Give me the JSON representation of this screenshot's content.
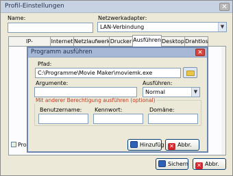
{
  "window": {
    "title": "Profil-Einstellungen",
    "close_glyph": "✕"
  },
  "name": {
    "label": "Name:",
    "value": ""
  },
  "adapter": {
    "label": "Netzwerkadapter:",
    "value": "LAN-Verbindung",
    "arrow": "▼"
  },
  "tabs": [
    {
      "label": "IP-Einstellungen"
    },
    {
      "label": "Internet"
    },
    {
      "label": "Netzlaufwerke"
    },
    {
      "label": "Drucker"
    },
    {
      "label": "Ausführen",
      "active": true
    },
    {
      "label": "Desktop"
    },
    {
      "label": "Drahtlos"
    }
  ],
  "panel": {
    "partial_label": "Pro"
  },
  "footer": {
    "save_label": "Sichern",
    "cancel_label": "Abbr."
  },
  "dialog": {
    "title": "Programm ausführen",
    "close_glyph": "✕",
    "path_label": "Pfad:",
    "path_value": "C:\\Programme\\Movie Maker\\moviemk.exe",
    "arguments_label": "Argumente:",
    "arguments_value": "",
    "run_label": "Ausführen:",
    "run_value": "Normal",
    "run_arrow": "▼",
    "group_title": "Mit anderer Berechtigung ausführen (optional)",
    "username_label": "Benutzername:",
    "password_label": "Kennwort:",
    "domain_label": "Domäne:",
    "add_label": "Hinzufüg",
    "cancel_label": "Abbr."
  },
  "colors": {
    "accent": "#003c74",
    "group_title": "#c33b1f",
    "titlebar": "#c7d2e3"
  },
  "icons": {
    "save": "save-icon",
    "cancel": "cancel-icon",
    "browse": "folder-icon"
  }
}
